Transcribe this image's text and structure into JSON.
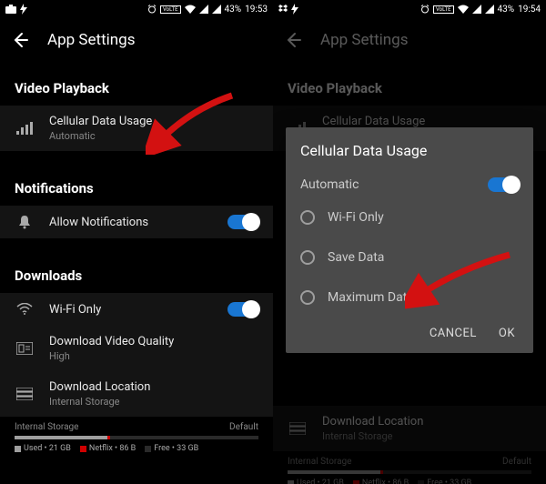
{
  "status": {
    "battery": "43%",
    "time_left": "19:53",
    "time_right": "19:54",
    "volte": "VoLTE"
  },
  "app": {
    "title": "App Settings"
  },
  "sections": {
    "playback": {
      "title": "Video Playback",
      "cellular": {
        "label": "Cellular Data Usage",
        "sub": "Automatic"
      }
    },
    "notifications": {
      "title": "Notifications",
      "allow": {
        "label": "Allow Notifications"
      }
    },
    "downloads": {
      "title": "Downloads",
      "wifi": {
        "label": "Wi-Fi Only"
      },
      "quality": {
        "label": "Download Video Quality",
        "sub": "High"
      },
      "location": {
        "label": "Download Location",
        "sub": "Internal Storage"
      }
    }
  },
  "storage": {
    "label": "Internal Storage",
    "default": "Default",
    "used": "Used • 21 GB",
    "netflix": "Netflix • 86 B",
    "free": "Free • 33 GB"
  },
  "dialog": {
    "title": "Cellular Data Usage",
    "automatic": "Automatic",
    "options": [
      "Wi-Fi Only",
      "Save Data",
      "Maximum Data"
    ],
    "cancel": "CANCEL",
    "ok": "OK"
  },
  "colors": {
    "accent": "#1976d2",
    "arrow": "#d31111"
  }
}
